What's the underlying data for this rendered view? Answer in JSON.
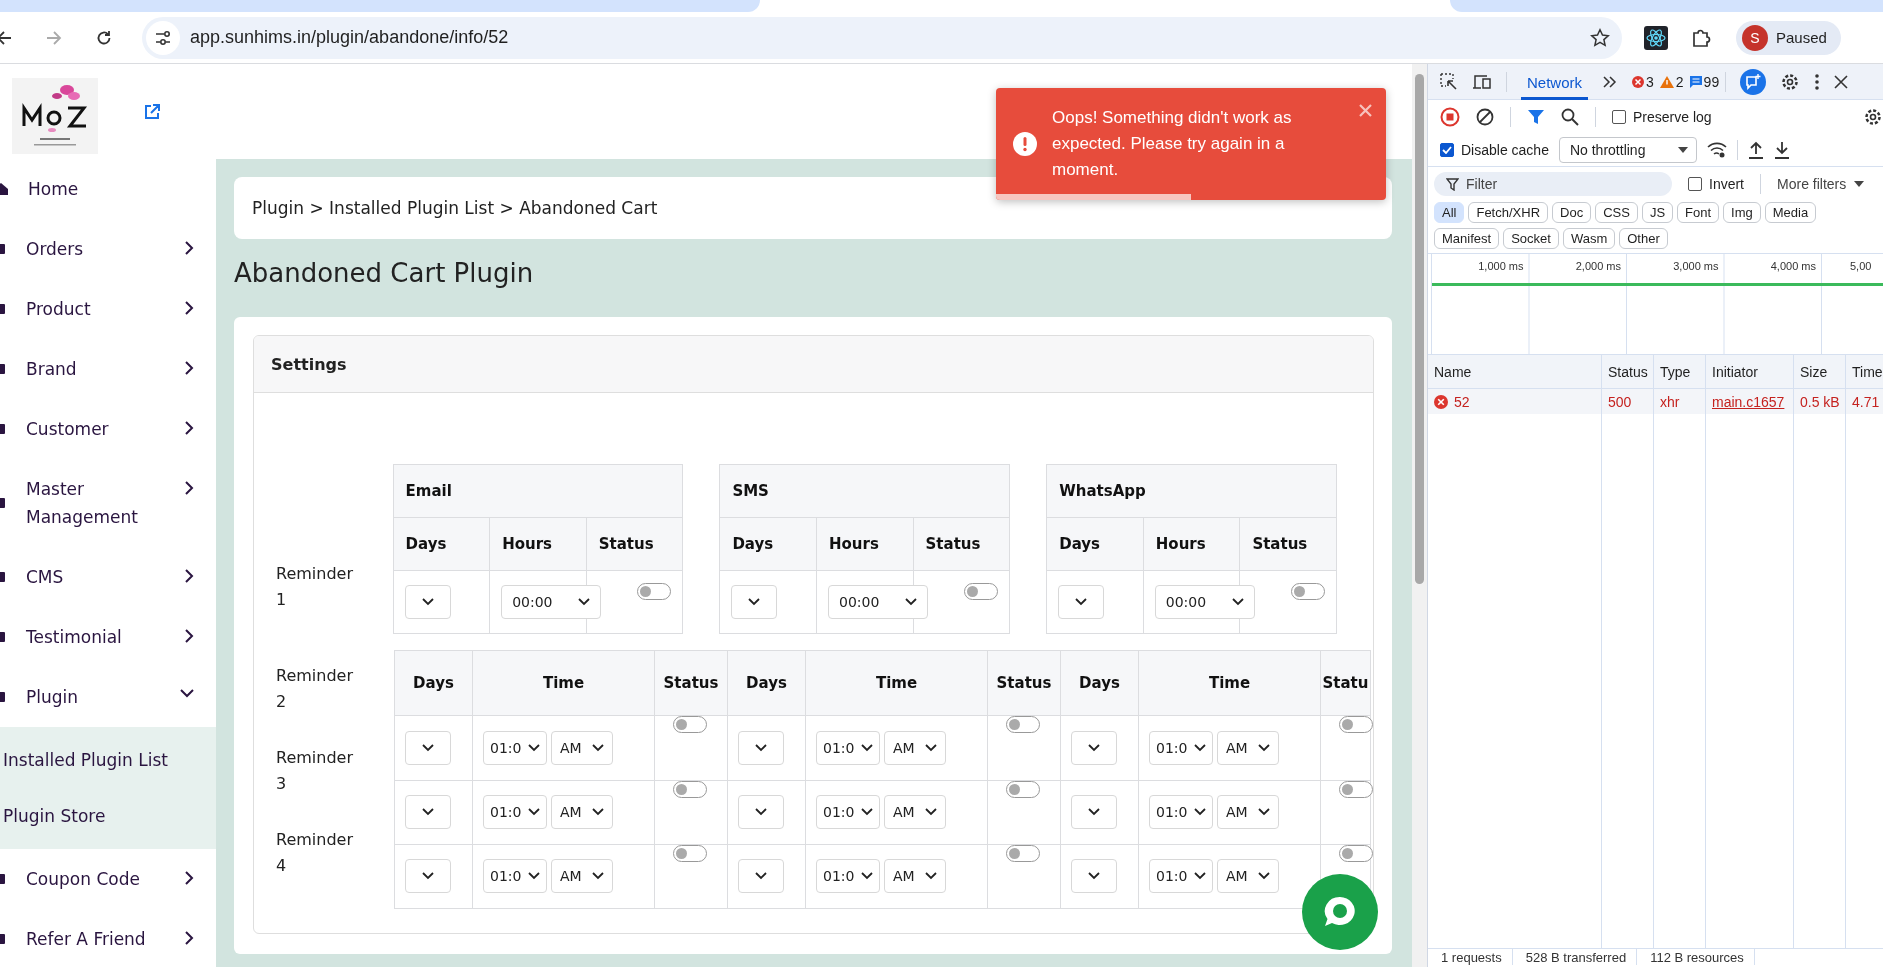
{
  "browser": {
    "url": "app.sunhims.in/plugin/abandone/info/52",
    "profile_initial": "S",
    "profile_status": "Paused"
  },
  "sidebar": {
    "items": [
      {
        "label": "Home",
        "kind": "link"
      },
      {
        "label": "Orders",
        "kind": "menu",
        "expanded": false
      },
      {
        "label": "Product",
        "kind": "menu",
        "expanded": false
      },
      {
        "label": "Brand",
        "kind": "menu",
        "expanded": false
      },
      {
        "label": "Customer",
        "kind": "menu",
        "expanded": false
      },
      {
        "label": "Master Management",
        "kind": "menu",
        "expanded": false
      },
      {
        "label": "CMS",
        "kind": "menu",
        "expanded": false
      },
      {
        "label": "Testimonial",
        "kind": "menu",
        "expanded": false
      },
      {
        "label": "Plugin",
        "kind": "menu",
        "expanded": true,
        "children": [
          {
            "label": "Installed Plugin List"
          },
          {
            "label": "Plugin Store"
          }
        ]
      },
      {
        "label": "Coupon Code",
        "kind": "menu",
        "expanded": false
      },
      {
        "label": "Refer A Friend",
        "kind": "menu",
        "expanded": false
      }
    ]
  },
  "breadcrumb": "Plugin > Installed Plugin List > Abandoned Cart",
  "page_title": "Abandoned Cart Plugin",
  "settings": {
    "title": "Settings",
    "first_reminder": {
      "label": "Reminder 1",
      "channels": [
        {
          "name": "Email",
          "columns": [
            "Days",
            "Hours",
            "Status"
          ],
          "hours": "00:00",
          "status": false
        },
        {
          "name": "SMS",
          "columns": [
            "Days",
            "Hours",
            "Status"
          ],
          "hours": "00:00",
          "status": false
        },
        {
          "name": "WhatsApp",
          "columns": [
            "Days",
            "Hours",
            "Status"
          ],
          "hours": "00:00",
          "status": false
        }
      ]
    },
    "later_reminders": {
      "columns": [
        "Days",
        "Time",
        "Status",
        "Days",
        "Time",
        "Status",
        "Days",
        "Time",
        "Statu"
      ],
      "rows": [
        {
          "label": "Reminder 2",
          "cells": [
            {
              "kind": "days"
            },
            {
              "kind": "time",
              "time": "01:0",
              "meridiem": "AM"
            },
            {
              "kind": "status",
              "status": false
            },
            {
              "kind": "days"
            },
            {
              "kind": "time",
              "time": "01:0",
              "meridiem": "AM"
            },
            {
              "kind": "status",
              "status": false
            },
            {
              "kind": "days"
            },
            {
              "kind": "time",
              "time": "01:0",
              "meridiem": "AM"
            },
            {
              "kind": "status",
              "status": false
            }
          ]
        },
        {
          "label": "Reminder 3",
          "cells": [
            {
              "kind": "days"
            },
            {
              "kind": "time",
              "time": "01:0",
              "meridiem": "AM"
            },
            {
              "kind": "status",
              "status": false
            },
            {
              "kind": "days"
            },
            {
              "kind": "time",
              "time": "01:0",
              "meridiem": "AM"
            },
            {
              "kind": "status",
              "status": false
            },
            {
              "kind": "days"
            },
            {
              "kind": "time",
              "time": "01:0",
              "meridiem": "AM"
            },
            {
              "kind": "status",
              "status": false
            }
          ]
        },
        {
          "label": "Reminder 4",
          "cells": [
            {
              "kind": "days"
            },
            {
              "kind": "time",
              "time": "01:0",
              "meridiem": "AM"
            },
            {
              "kind": "status",
              "status": false
            },
            {
              "kind": "days"
            },
            {
              "kind": "time",
              "time": "01:0",
              "meridiem": "AM"
            },
            {
              "kind": "status",
              "status": false
            },
            {
              "kind": "days"
            },
            {
              "kind": "time",
              "time": "01:0",
              "meridiem": "AM"
            },
            {
              "kind": "status",
              "status": false
            }
          ]
        }
      ]
    }
  },
  "toast": {
    "message": "Oops! Something didn't work as expected. Please try again in a moment.",
    "level": 0.5
  },
  "devtools": {
    "tabs": [
      {
        "label": "Network",
        "selected": true
      }
    ],
    "errors": "3",
    "warnings": "2",
    "messages": "99",
    "preserve_log": {
      "label": "Preserve log",
      "checked": false
    },
    "disable_cache": {
      "label": "Disable cache",
      "checked": true
    },
    "throttling": "No throttling",
    "filter_placeholder": "Filter",
    "invert": {
      "label": "Invert",
      "checked": false
    },
    "more_filters": "More filters",
    "chips": [
      {
        "label": "All",
        "selected": true
      },
      {
        "label": "Fetch/XHR",
        "selected": false
      },
      {
        "label": "Doc",
        "selected": false
      },
      {
        "label": "CSS",
        "selected": false
      },
      {
        "label": "JS",
        "selected": false
      },
      {
        "label": "Font",
        "selected": false
      },
      {
        "label": "Img",
        "selected": false
      },
      {
        "label": "Media",
        "selected": false
      },
      {
        "label": "Manifest",
        "selected": false
      },
      {
        "label": "Socket",
        "selected": false
      },
      {
        "label": "Wasm",
        "selected": false
      },
      {
        "label": "Other",
        "selected": false
      }
    ],
    "timeline_ticks": [
      "1,000 ms",
      "2,000 ms",
      "3,000 ms",
      "4,000 ms",
      "5,00"
    ],
    "columns": [
      "Name",
      "Status",
      "Type",
      "Initiator",
      "Size",
      "Time"
    ],
    "requests": [
      {
        "name": "52",
        "status": "500",
        "type": "xhr",
        "initiator": "main.c1657",
        "size": "0.5 kB",
        "time": "4.71",
        "failed": true
      }
    ],
    "summary": [
      "1 requests",
      "528 B transferred",
      "112 B resources"
    ]
  }
}
